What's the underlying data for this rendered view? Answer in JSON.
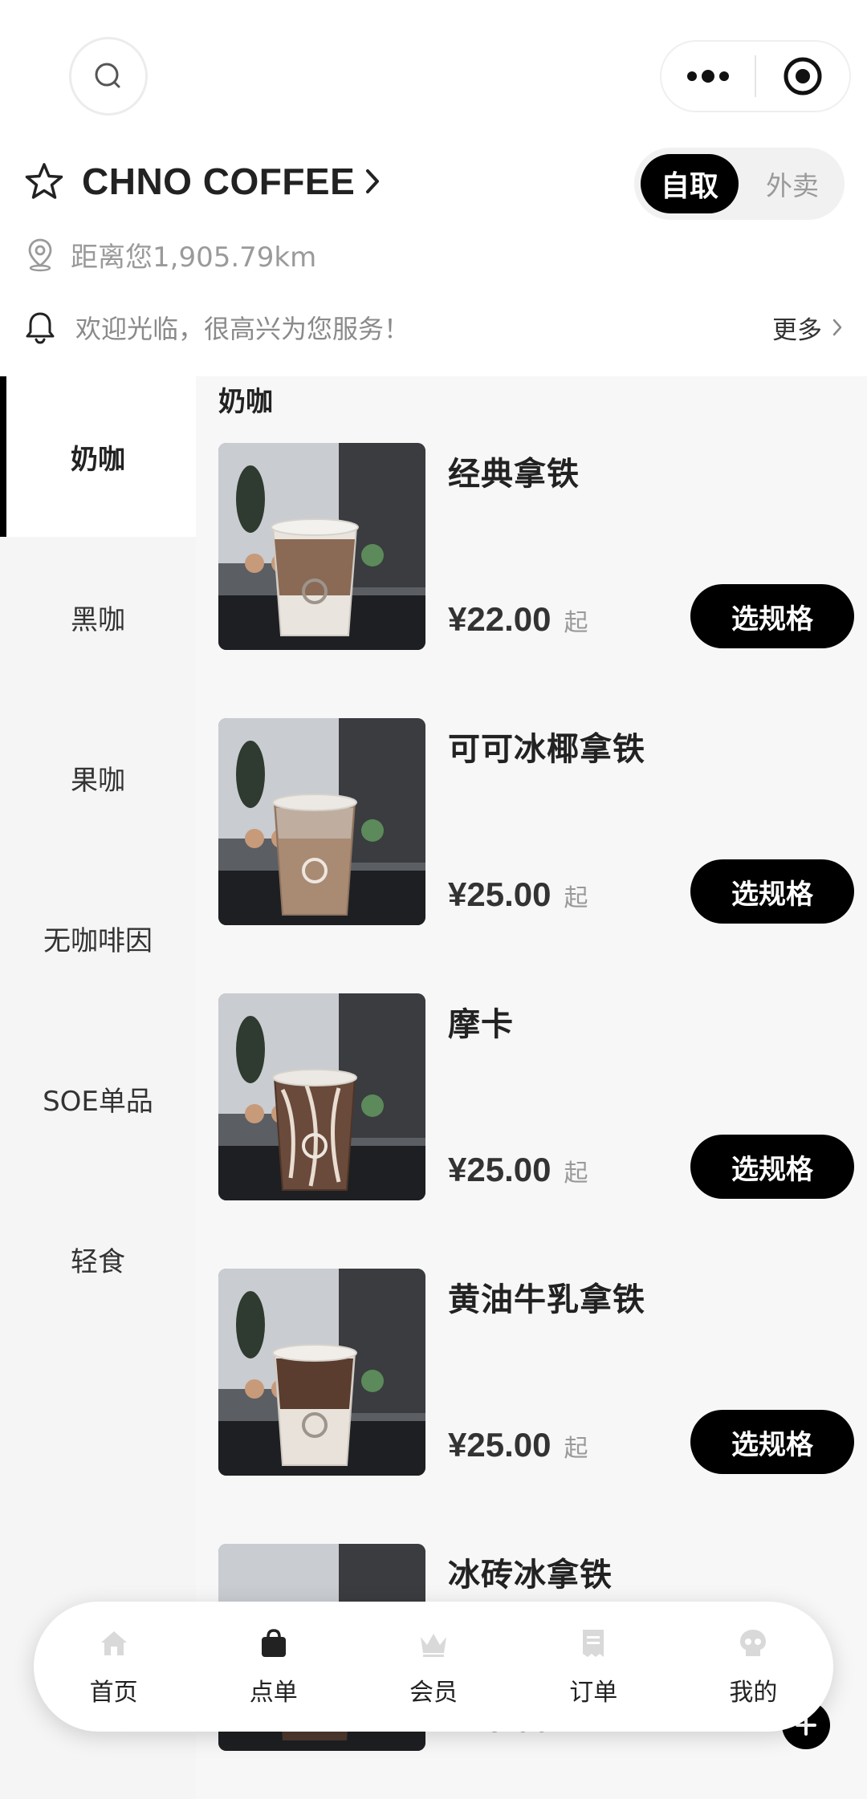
{
  "header": {
    "search_icon": "search-icon",
    "menu_icon": "more-dots-icon",
    "close_icon": "target-circle-icon"
  },
  "store": {
    "name": "CHNO COFFEE",
    "mode_active": "自取",
    "mode_inactive": "外卖",
    "distance": "距离您1,905.79km",
    "notice": "欢迎光临，很高兴为您服务！",
    "more": "更多"
  },
  "categories": [
    "奶咖",
    "黑咖",
    "果咖",
    "无咖啡因",
    "SOE单品",
    "轻食"
  ],
  "section_title": "奶咖",
  "products": [
    {
      "name": "经典拿铁",
      "price": "¥22.00",
      "suffix": "起",
      "button": "选规格"
    },
    {
      "name": "可可冰椰拿铁",
      "price": "¥25.00",
      "suffix": "起",
      "button": "选规格"
    },
    {
      "name": "摩卡",
      "price": "¥25.00",
      "suffix": "起",
      "button": "选规格"
    },
    {
      "name": "黄油牛乳拿铁",
      "price": "¥25.00",
      "suffix": "起",
      "button": "选规格"
    },
    {
      "name": "冰砖冰拿铁",
      "price": "¥25.00",
      "suffix": "",
      "button": ""
    }
  ],
  "tabbar": [
    {
      "label": "首页",
      "icon": "home-icon"
    },
    {
      "label": "点单",
      "icon": "shopping-bag-icon"
    },
    {
      "label": "会员",
      "icon": "crown-icon"
    },
    {
      "label": "订单",
      "icon": "receipt-icon"
    },
    {
      "label": "我的",
      "icon": "skull-icon"
    }
  ],
  "colors": {
    "accent": "#000000",
    "sidebar_bg": "#f5f5f6",
    "content_bg": "#f7f7f8"
  }
}
